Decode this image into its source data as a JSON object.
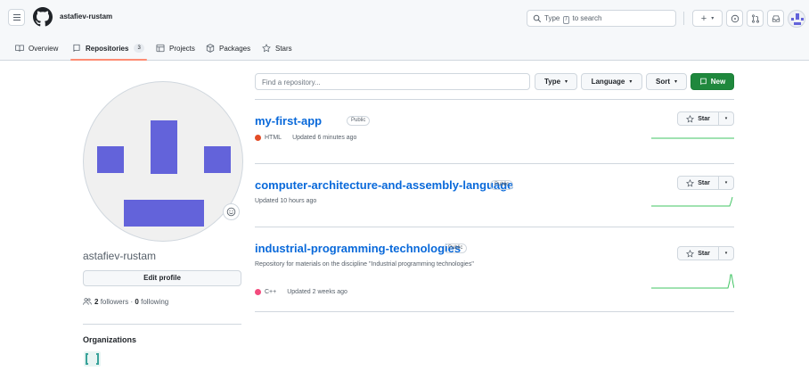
{
  "header": {
    "owner": "astafiev-rustam",
    "search": {
      "prefix": "Type",
      "key": "/",
      "suffix": "to search"
    },
    "plus_label": "+",
    "caret": "▾"
  },
  "tabs": [
    {
      "label": "Overview"
    },
    {
      "label": "Repositories",
      "count": "3"
    },
    {
      "label": "Projects"
    },
    {
      "label": "Packages"
    },
    {
      "label": "Stars"
    }
  ],
  "profile": {
    "username": "astafiev-rustam",
    "edit_label": "Edit profile",
    "followers": "2",
    "followers_label": "followers",
    "dot": "·",
    "following": "0",
    "following_label": "following",
    "orgs_title": "Organizations"
  },
  "filters": {
    "find_placeholder": "Find a repository...",
    "type_label": "Type",
    "language_label": "Language",
    "sort_label": "Sort",
    "new_label": "New",
    "caret": "▾"
  },
  "repos": [
    {
      "name": "my-first-app",
      "visibility": "Public",
      "language": "HTML",
      "language_color": "#e34c26",
      "updated": "Updated 6 minutes ago",
      "star_label": "Star"
    },
    {
      "name": "computer-architecture-and-assembly-language",
      "visibility": "Public",
      "updated": "Updated 10 hours ago",
      "star_label": "Star"
    },
    {
      "name": "industrial-programming-technologies",
      "visibility": "Public",
      "description": "Repository for materials on the discipline \"Industrial programming technologies\"",
      "language": "C++",
      "language_color": "#f34b7d",
      "updated": "Updated 2 weeks ago",
      "star_label": "Star"
    }
  ],
  "colors": {
    "accent_green": "#1f883d",
    "link_blue": "#0969da",
    "avatar_blocks": "#6363da",
    "tab_underline": "#fd8c73"
  }
}
